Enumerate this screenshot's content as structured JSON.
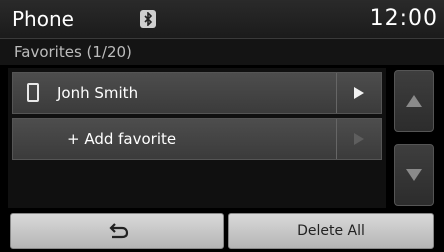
{
  "header": {
    "title": "Phone",
    "bluetooth_icon": "bluetooth-icon",
    "clock": "12:00"
  },
  "favorites": {
    "heading": "Favorites (1/20)",
    "items": [
      {
        "name": "Jonh Smith",
        "icon": "phone-icon"
      }
    ],
    "add_label": "+ Add favorite"
  },
  "scroll": {
    "up_icon": "triangle-up-icon",
    "down_icon": "triangle-down-icon"
  },
  "bottom": {
    "back_icon": "back-arrow-icon",
    "delete_all_label": "Delete All"
  }
}
